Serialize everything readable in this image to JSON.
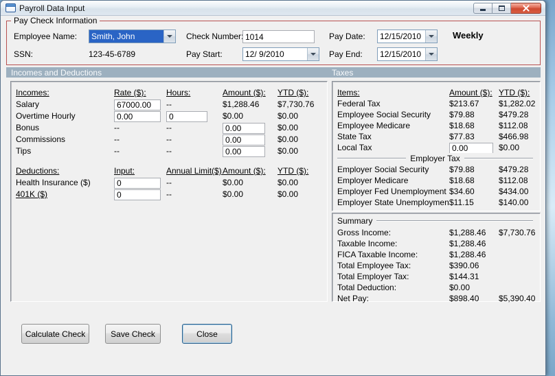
{
  "window": {
    "title": "Payroll Data Input"
  },
  "paycheck": {
    "title": "Pay Check Information",
    "employee_name_label": "Employee Name:",
    "employee_name_value": "Smith, John",
    "ssn_label": "SSN:",
    "ssn_value": "123-45-6789",
    "check_number_label": "Check Number:",
    "check_number_value": "1014",
    "pay_start_label": "Pay Start:",
    "pay_start_value": "12/ 9/2010",
    "pay_date_label": "Pay Date:",
    "pay_date_value": "12/15/2010",
    "pay_end_label": "Pay End:",
    "pay_end_value": "12/15/2010",
    "frequency": "Weekly"
  },
  "sections": {
    "left": "Incomes and Deductions",
    "right": "Taxes"
  },
  "incomes": {
    "headers": {
      "name": "Incomes:",
      "rate": "Rate ($):",
      "hours": "Hours:",
      "amount": "Amount ($):",
      "ytd": "YTD ($):"
    },
    "salary": {
      "label": "Salary",
      "rate": "67000.00",
      "hours": "--",
      "amount": "$1,288.46",
      "ytd": "$7,730.76"
    },
    "overtime": {
      "label": "Overtime Hourly",
      "rate": "0.00",
      "hours": "0",
      "amount": "$0.00",
      "ytd": "$0.00"
    },
    "bonus": {
      "label": "Bonus",
      "rate": "--",
      "hours": "--",
      "amount": "0.00",
      "ytd": "$0.00"
    },
    "commissions": {
      "label": "Commissions",
      "rate": "--",
      "hours": "--",
      "amount": "0.00",
      "ytd": "$0.00"
    },
    "tips": {
      "label": "Tips",
      "rate": "--",
      "hours": "--",
      "amount": "0.00",
      "ytd": "$0.00"
    }
  },
  "deductions": {
    "headers": {
      "name": "Deductions:",
      "input": "Input:",
      "limit": "Annual Limit($):",
      "amount": "Amount ($):",
      "ytd": "YTD ($):"
    },
    "health": {
      "label": "Health Insurance  ($)",
      "input": "0",
      "limit": "--",
      "amount": "$0.00",
      "ytd": "$0.00"
    },
    "k401": {
      "label": "401K  ($)",
      "input": "0",
      "limit": "--",
      "amount": "$0.00",
      "ytd": "$0.00"
    }
  },
  "taxes": {
    "headers": {
      "items": "Items:",
      "amount": "Amount ($):",
      "ytd": "YTD ($):"
    },
    "rows": [
      {
        "label": "Federal Tax",
        "amount": "$213.67",
        "ytd": "$1,282.02"
      },
      {
        "label": "Employee Social Security",
        "amount": "$79.88",
        "ytd": "$479.28"
      },
      {
        "label": "Employee Medicare",
        "amount": "$18.68",
        "ytd": "$112.08"
      },
      {
        "label": "State Tax",
        "amount": "$77.83",
        "ytd": "$466.98"
      }
    ],
    "local": {
      "label": "Local Tax",
      "amount": "0.00",
      "ytd": "$0.00"
    },
    "employer_divider": "Employer Tax",
    "employer_rows": [
      {
        "label": "Employer Social Security",
        "amount": "$79.88",
        "ytd": "$479.28"
      },
      {
        "label": "Employer Medicare",
        "amount": "$18.68",
        "ytd": "$112.08"
      },
      {
        "label": "Employer Fed Unemployment",
        "amount": "$34.60",
        "ytd": "$434.00"
      },
      {
        "label": "Employer State Unemployment",
        "amount": "$11.15",
        "ytd": "$140.00"
      }
    ]
  },
  "summary": {
    "title": "Summary",
    "rows": [
      {
        "label": "Gross Income:",
        "amount": "$1,288.46",
        "ytd": "$7,730.76"
      },
      {
        "label": "Taxable Income:",
        "amount": "$1,288.46",
        "ytd": ""
      },
      {
        "label": "FICA Taxable Income:",
        "amount": "$1,288.46",
        "ytd": ""
      },
      {
        "label": "Total Employee Tax:",
        "amount": "$390.06",
        "ytd": ""
      },
      {
        "label": "Total Employer Tax:",
        "amount": "$144.31",
        "ytd": ""
      },
      {
        "label": "Total Deduction:",
        "amount": "$0.00",
        "ytd": ""
      },
      {
        "label": "Net Pay:",
        "amount": "$898.40",
        "ytd": "$5,390.40"
      }
    ]
  },
  "buttons": {
    "calculate": "Calculate Check",
    "save": "Save Check",
    "close": "Close"
  }
}
